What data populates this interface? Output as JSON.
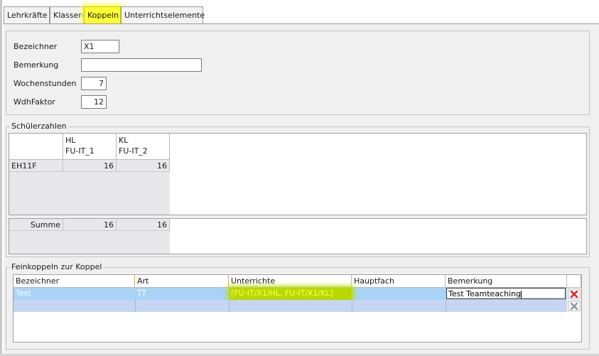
{
  "tabs": [
    {
      "label": "Lehrkräfte",
      "active": false
    },
    {
      "label": "Klassen",
      "active": false
    },
    {
      "label": "Koppeln",
      "active": true
    },
    {
      "label": "Unterrichtselemente",
      "active": false
    }
  ],
  "form": {
    "bezeichner_label": "Bezeichner",
    "bezeichner_value": "X1",
    "bemerkung_label": "Bemerkung",
    "bemerkung_value": "",
    "wochenstunden_label": "Wochenstunden",
    "wochenstunden_value": "7",
    "wdhfaktor_label": "WdhFaktor",
    "wdhfaktor_value": "12"
  },
  "schuelerzahlen": {
    "title": "Schülerzahlen",
    "columns": [
      {
        "line1": "HL",
        "line2": "FU-IT_1"
      },
      {
        "line1": "KL",
        "line2": "FU-IT_2"
      }
    ],
    "rows": [
      {
        "label": "EH11F",
        "values": [
          "16",
          "16"
        ]
      }
    ],
    "summe": {
      "label": "Summe",
      "values": [
        "16",
        "16"
      ]
    }
  },
  "feinkoppeln": {
    "title": "Feinkoppeln zur Koppel",
    "columns": [
      "Bezeichner",
      "Art",
      "Unterrichte",
      "Hauptfach",
      "Bemerkung"
    ],
    "rows": [
      {
        "bezeichner": "Test",
        "art": "TT",
        "unterrichte": "[FU-IT/X1/HL, FU-IT/X1/KL]",
        "hauptfach": "",
        "bemerkung": "Test Teamteaching"
      }
    ]
  },
  "icons": {
    "delete_active": "delete-x-icon",
    "delete_inactive": "delete-x-disabled-icon"
  },
  "colors": {
    "selected_row": "#a8d4f8",
    "empty_row": "#c6d6f2",
    "highlight_yellow": "#ffff33",
    "highlight_green": "#b8d800",
    "delete_red": "#e02020"
  }
}
